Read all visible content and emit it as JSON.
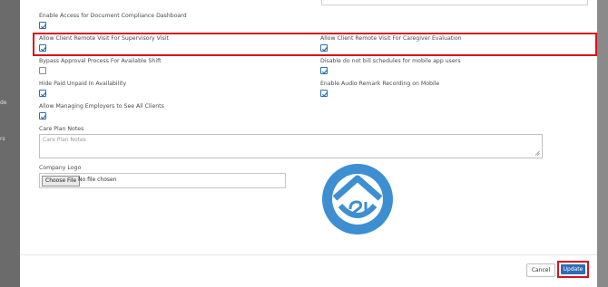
{
  "background": {
    "left_labels": [
      "de",
      "rs"
    ]
  },
  "form": {
    "fields": {
      "enable_doc_compliance": {
        "label": "Enable Access for Document Compliance Dashboard",
        "checked": true
      },
      "allow_remote_supervisory": {
        "label": "Allow Client Remote Visit For Supervisory Visit",
        "checked": true
      },
      "allow_remote_caregiver_eval": {
        "label": "Allow Client Remote Visit For Caregiver Evaluation",
        "checked": true
      },
      "bypass_approval": {
        "label": "Bypass Approval Process For Available Shift",
        "checked": false
      },
      "disable_not_bill": {
        "label": "Disable do not bill schedules for mobile app users",
        "checked": true
      },
      "hide_paid_unpaid": {
        "label": "Hide Paid Unpaid In Availability",
        "checked": true
      },
      "enable_audio_remark": {
        "label": "Enable Audio Remark Recording on Mobile",
        "checked": true
      },
      "allow_managing_employers": {
        "label": "Allow Managing Employers to See All Clients",
        "checked": true
      }
    },
    "care_plan_notes": {
      "label": "Care Plan Notes",
      "placeholder": "Care Plan Notes"
    },
    "company_logo": {
      "label": "Company Logo",
      "button_label": "Choose File",
      "file_status": "No file chosen"
    }
  },
  "footer": {
    "cancel_label": "Cancel",
    "update_label": "Update"
  },
  "colors": {
    "accent": "#2e6db5",
    "highlight": "#d4141c",
    "logo": "#3d8fd1"
  },
  "icons": [
    "checkmark-icon",
    "resize-grip-icon",
    "company-logo-icon"
  ]
}
